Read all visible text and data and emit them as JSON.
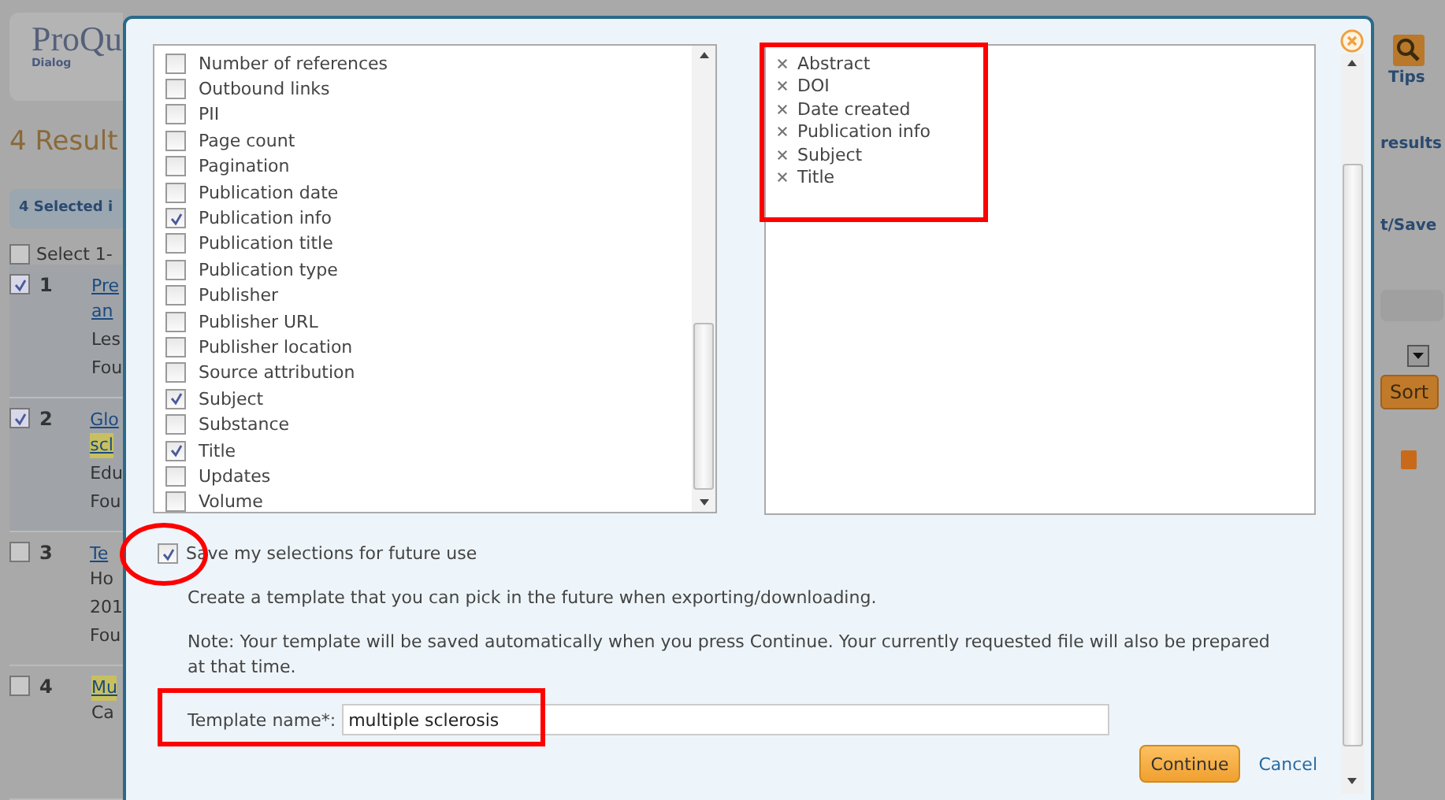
{
  "background_page": {
    "logo": {
      "text": "ProQu",
      "subtext": "Dialog"
    },
    "results_heading": "4 Result",
    "selected_bar": "4 Selected i",
    "select_all": {
      "label": "Select 1-",
      "checked": false
    },
    "results": [
      {
        "number": "1",
        "checked": true,
        "lines": [
          {
            "text": "Pre",
            "kind": "link",
            "highlight": false
          },
          {
            "text": "an",
            "kind": "link",
            "highlight": false
          },
          {
            "text": "Les",
            "kind": "plain",
            "highlight": false
          },
          {
            "text": "Fou",
            "kind": "plain",
            "highlight": false
          }
        ]
      },
      {
        "number": "2",
        "checked": true,
        "lines": [
          {
            "text": "Glo",
            "kind": "link",
            "highlight": false
          },
          {
            "text": "scl",
            "kind": "link",
            "highlight": true
          },
          {
            "text": "Edu",
            "kind": "plain",
            "highlight": false
          },
          {
            "text": "Fou",
            "kind": "plain",
            "highlight": false
          }
        ]
      },
      {
        "number": "3",
        "checked": false,
        "lines": [
          {
            "text": "Te",
            "kind": "link",
            "highlight": false
          },
          {
            "text": "Ho",
            "kind": "plain",
            "highlight": false
          },
          {
            "text": "201",
            "kind": "plain",
            "highlight": false
          },
          {
            "text": "Fou",
            "kind": "plain",
            "highlight": false
          }
        ]
      },
      {
        "number": "4",
        "checked": false,
        "lines": [
          {
            "text": "Mu",
            "kind": "link",
            "highlight": true
          },
          {
            "text": "Ca",
            "kind": "plain",
            "highlight": false
          }
        ]
      }
    ],
    "tips": "Tips",
    "results_link": "results",
    "export_button": "t/Save",
    "sort_button": "Sort"
  },
  "dialog": {
    "fields": [
      {
        "label": "Number of references",
        "checked": false
      },
      {
        "label": "Outbound links",
        "checked": false
      },
      {
        "label": "PII",
        "checked": false
      },
      {
        "label": "Page count",
        "checked": false
      },
      {
        "label": "Pagination",
        "checked": false
      },
      {
        "label": "Publication date",
        "checked": false
      },
      {
        "label": "Publication info",
        "checked": true
      },
      {
        "label": "Publication title",
        "checked": false
      },
      {
        "label": "Publication type",
        "checked": false
      },
      {
        "label": "Publisher",
        "checked": false
      },
      {
        "label": "Publisher URL",
        "checked": false
      },
      {
        "label": "Publisher location",
        "checked": false
      },
      {
        "label": "Source attribution",
        "checked": false
      },
      {
        "label": "Subject",
        "checked": true
      },
      {
        "label": "Substance",
        "checked": false
      },
      {
        "label": "Title",
        "checked": true
      },
      {
        "label": "Updates",
        "checked": false
      },
      {
        "label": "Volume",
        "checked": false
      }
    ],
    "selected_fields": [
      "Abstract",
      "DOI",
      "Date created",
      "Publication info",
      "Subject",
      "Title"
    ],
    "save_selections": {
      "label": "Save my selections for future use",
      "checked": true
    },
    "template_hint": "Create a template that you can pick in the future when exporting/downloading.",
    "note": "Note: Your template will be saved automatically when you press Continue. Your currently requested file will also be prepared at that time.",
    "template_name": {
      "label": "Template name*:",
      "value": "multiple sclerosis"
    },
    "continue_button": "Continue",
    "cancel_link": "Cancel"
  }
}
